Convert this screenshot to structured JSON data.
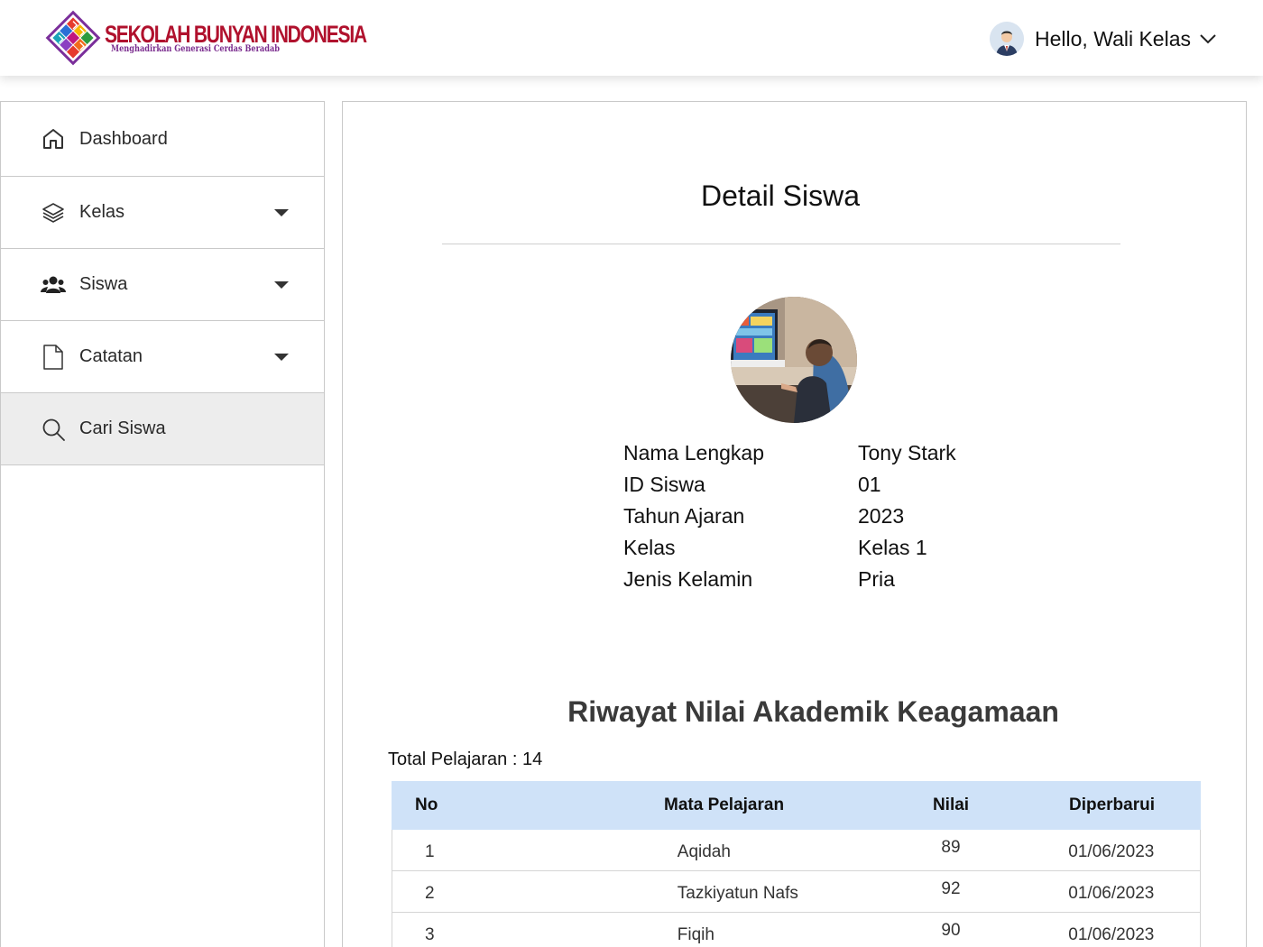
{
  "header": {
    "logo_title": "SEKOLAH BUNYAN INDONESIA",
    "logo_subtitle": "Menghadirkan Generasi Cerdas Beradab",
    "greeting": "Hello, Wali Kelas"
  },
  "sidebar": {
    "items": [
      {
        "label": "Dashboard",
        "icon": "home-icon"
      },
      {
        "label": "Kelas",
        "icon": "layers-icon"
      },
      {
        "label": "Siswa",
        "icon": "users-icon"
      },
      {
        "label": "Catatan",
        "icon": "file-icon"
      },
      {
        "label": "Cari Siswa",
        "icon": "search-icon"
      }
    ]
  },
  "main": {
    "title": "Detail Siswa",
    "student": {
      "rows": [
        {
          "label": "Nama Lengkap",
          "value": "Tony Stark"
        },
        {
          "label": "ID Siswa",
          "value": "01"
        },
        {
          "label": "Tahun Ajaran",
          "value": "2023"
        },
        {
          "label": "Kelas",
          "value": "Kelas 1"
        },
        {
          "label": "Jenis Kelamin",
          "value": "Pria"
        }
      ]
    },
    "section_title": "Riwayat Nilai Akademik Keagamaan",
    "total": "Total Pelajaran : 14",
    "table": {
      "headers": [
        "No",
        "Mata Pelajaran",
        "Nilai",
        "Diperbarui"
      ],
      "rows": [
        {
          "no": "1",
          "subject": "Aqidah",
          "score": "89",
          "updated": "01/06/2023"
        },
        {
          "no": "2",
          "subject": "Tazkiyatun Nafs",
          "score": "92",
          "updated": "01/06/2023"
        },
        {
          "no": "3",
          "subject": "Fiqih",
          "score": "90",
          "updated": "01/06/2023"
        }
      ]
    }
  },
  "colors": {
    "brand_red": "#b0112d",
    "table_header_bg": "#cfe2f8",
    "active_nav_bg": "#ededed"
  }
}
